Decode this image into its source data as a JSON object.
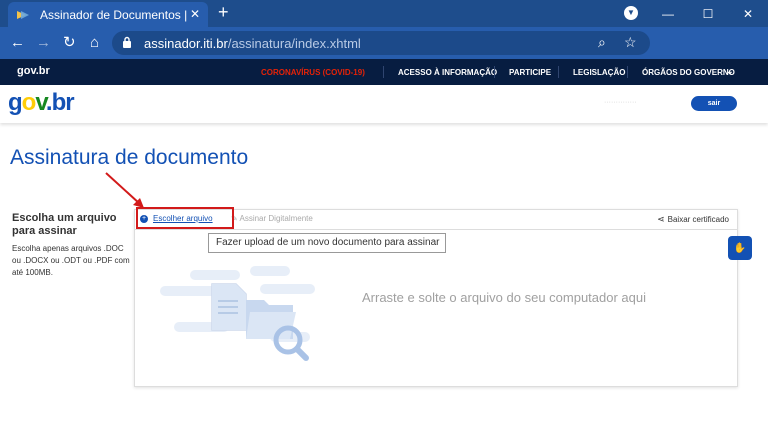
{
  "browser": {
    "tab_title": "Assinador de Documentos | Assi",
    "tab_close": "✕",
    "new_tab": "+",
    "url_domain": "assinador.iti.br",
    "url_path": "/assinatura/index.xhtml",
    "win_min": "—",
    "win_max": "☐",
    "win_close": "✕",
    "ext_sei": "sei"
  },
  "govbar": {
    "logo": "gov.br",
    "links": [
      "CORONAVÍRUS (COVID-19)",
      "ACESSO À INFORMAÇÃO",
      "PARTICIPE",
      "LEGISLAÇÃO",
      "ÓRGÃOS DO GOVERNO"
    ]
  },
  "header": {
    "logo": {
      "g": "g",
      "o": "o",
      "v": "v",
      "dot": ".",
      "b": "b",
      "r": "r"
    },
    "user": "··············",
    "logout": "sair"
  },
  "page": {
    "title": "Assinatura de documento",
    "side_heading": "Escolha um arquivo para assinar",
    "side_desc": "Escolha apenas arquivos .DOC ou .DOCX ou .ODT ou .PDF com até 100MB."
  },
  "toolbar": {
    "choose_file": "Escolher arquivo",
    "sign_digitally": "Assinar Digitalmente",
    "download_cert": "Baixar certificado"
  },
  "tooltip": "Fazer upload de um novo documento para assinar",
  "dropzone": {
    "text": "Arraste e solte o arquivo do seu computador aqui"
  },
  "colors": {
    "gov_blue": "#1351b4",
    "gov_dark": "#071d41",
    "alert_red": "#e52207",
    "annotation_red": "#d21a1a"
  }
}
